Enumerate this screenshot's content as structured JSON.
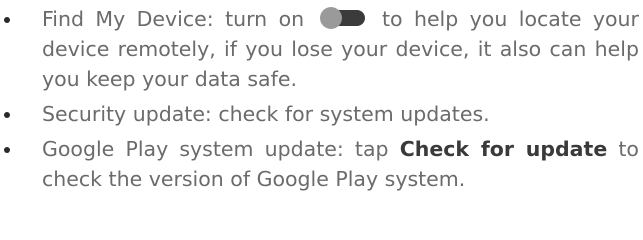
{
  "items": [
    {
      "prefix": "Find My Device: turn on",
      "toggle_icon": "toggle-switch-icon",
      "suffix": "to help you locate your device remotely, if you lose your device, it also can help you keep your data safe."
    },
    {
      "text": "Security update: check for system updates."
    },
    {
      "prefix": "Google Play system update: tap",
      "bold": "Check for update",
      "suffix": "to check the version of Google Play system."
    }
  ]
}
